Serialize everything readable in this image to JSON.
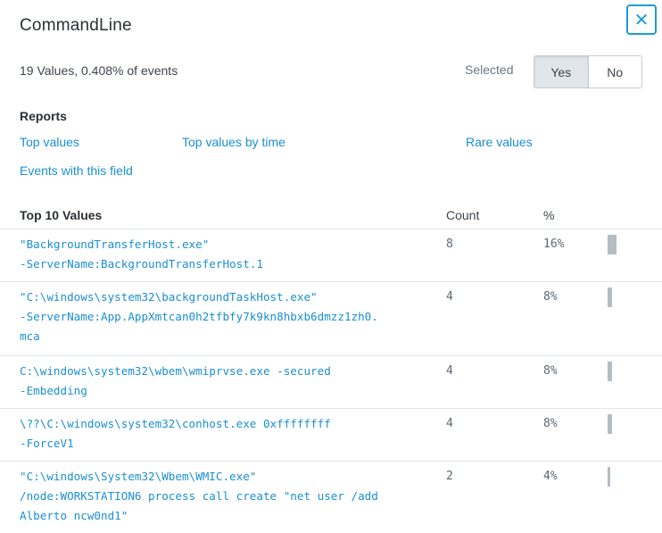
{
  "panel": {
    "title": "CommandLine",
    "close_icon": "✕",
    "summary": "19 Values, 0.408% of events",
    "selected_label": "Selected",
    "toggle": {
      "yes": "Yes",
      "no": "No",
      "active": "yes"
    }
  },
  "reports": {
    "heading": "Reports",
    "top_values": "Top values",
    "top_values_by_time": "Top values by time",
    "rare_values": "Rare values",
    "events_with_field": "Events with this field"
  },
  "table": {
    "headers": {
      "value": "Top 10 Values",
      "count": "Count",
      "percent": "%"
    },
    "rows": [
      {
        "value": "\"BackgroundTransferHost.exe\"\n-ServerName:BackgroundTransferHost.1",
        "count": "8",
        "percent": "16%",
        "share": 0.16
      },
      {
        "value": "\"C:\\windows\\system32\\backgroundTaskHost.exe\"\n-ServerName:App.AppXmtcan0h2tfbfy7k9kn8hbxb6dmzz1zh0.\nmca",
        "count": "4",
        "percent": "8%",
        "share": 0.08
      },
      {
        "value": "C:\\windows\\system32\\wbem\\wmiprvse.exe -secured\n-Embedding",
        "count": "4",
        "percent": "8%",
        "share": 0.08
      },
      {
        "value": "\\??\\C:\\windows\\system32\\conhost.exe 0xffffffff\n-ForceV1",
        "count": "4",
        "percent": "8%",
        "share": 0.08
      },
      {
        "value": "\"C:\\windows\\System32\\Wbem\\WMIC.exe\"\n/node:WORKSTATION6 process call create \"net user /add\nAlberto ncw0nd1\"",
        "count": "2",
        "percent": "4%",
        "share": 0.04
      }
    ]
  }
}
